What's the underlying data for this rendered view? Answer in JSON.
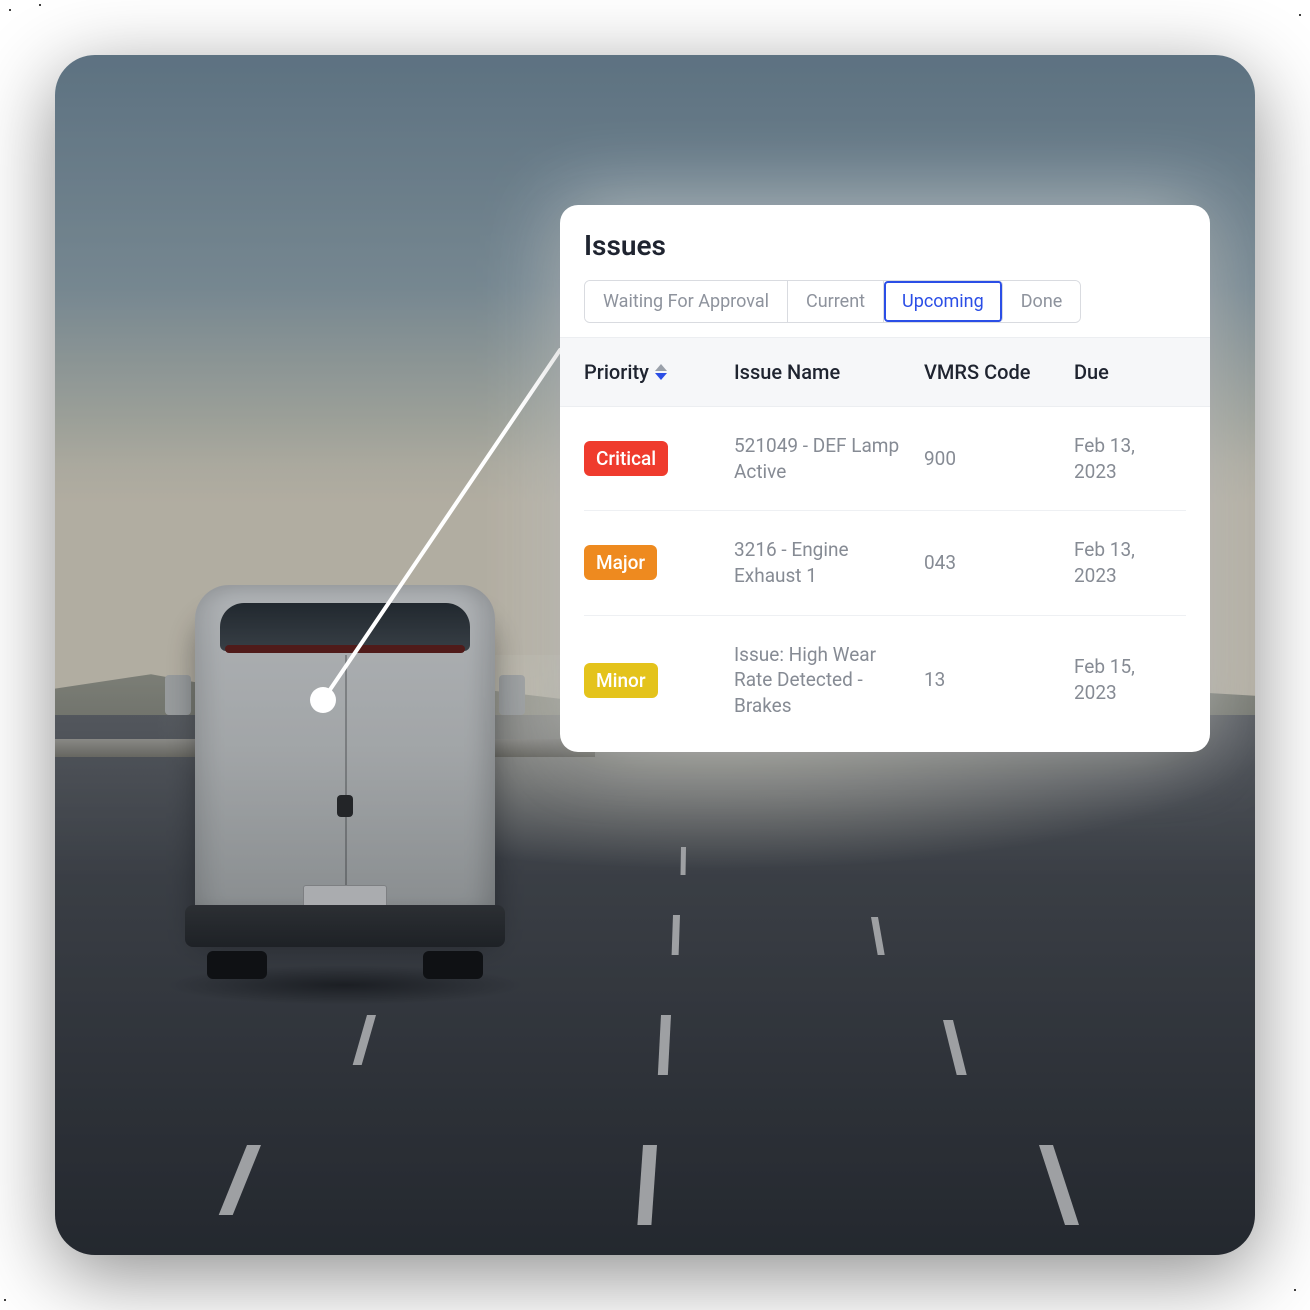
{
  "card": {
    "title": "Issues",
    "tabs": [
      {
        "label": "Waiting For Approval",
        "active": false
      },
      {
        "label": "Current",
        "active": false
      },
      {
        "label": "Upcoming",
        "active": true
      },
      {
        "label": "Done",
        "active": false
      }
    ],
    "columns": {
      "priority": "Priority",
      "issue_name": "Issue Name",
      "vmrs_code": "VMRS Code",
      "due": "Due"
    },
    "rows": [
      {
        "priority": "Critical",
        "priority_color": "#ef3b2d",
        "issue_name": "521049 - DEF Lamp Active",
        "vmrs_code": "900",
        "due": "Feb 13, 2023"
      },
      {
        "priority": "Major",
        "priority_color": "#ee8a1f",
        "issue_name": "3216 - Engine Exhaust 1",
        "vmrs_code": "043",
        "due": "Feb 13, 2023"
      },
      {
        "priority": "Minor",
        "priority_color": "#e4c31b",
        "issue_name": "Issue: High Wear Rate Detected - Brakes",
        "vmrs_code": "13",
        "due": "Feb 15, 2023"
      }
    ]
  },
  "colors": {
    "accent": "#2b4ee6"
  }
}
